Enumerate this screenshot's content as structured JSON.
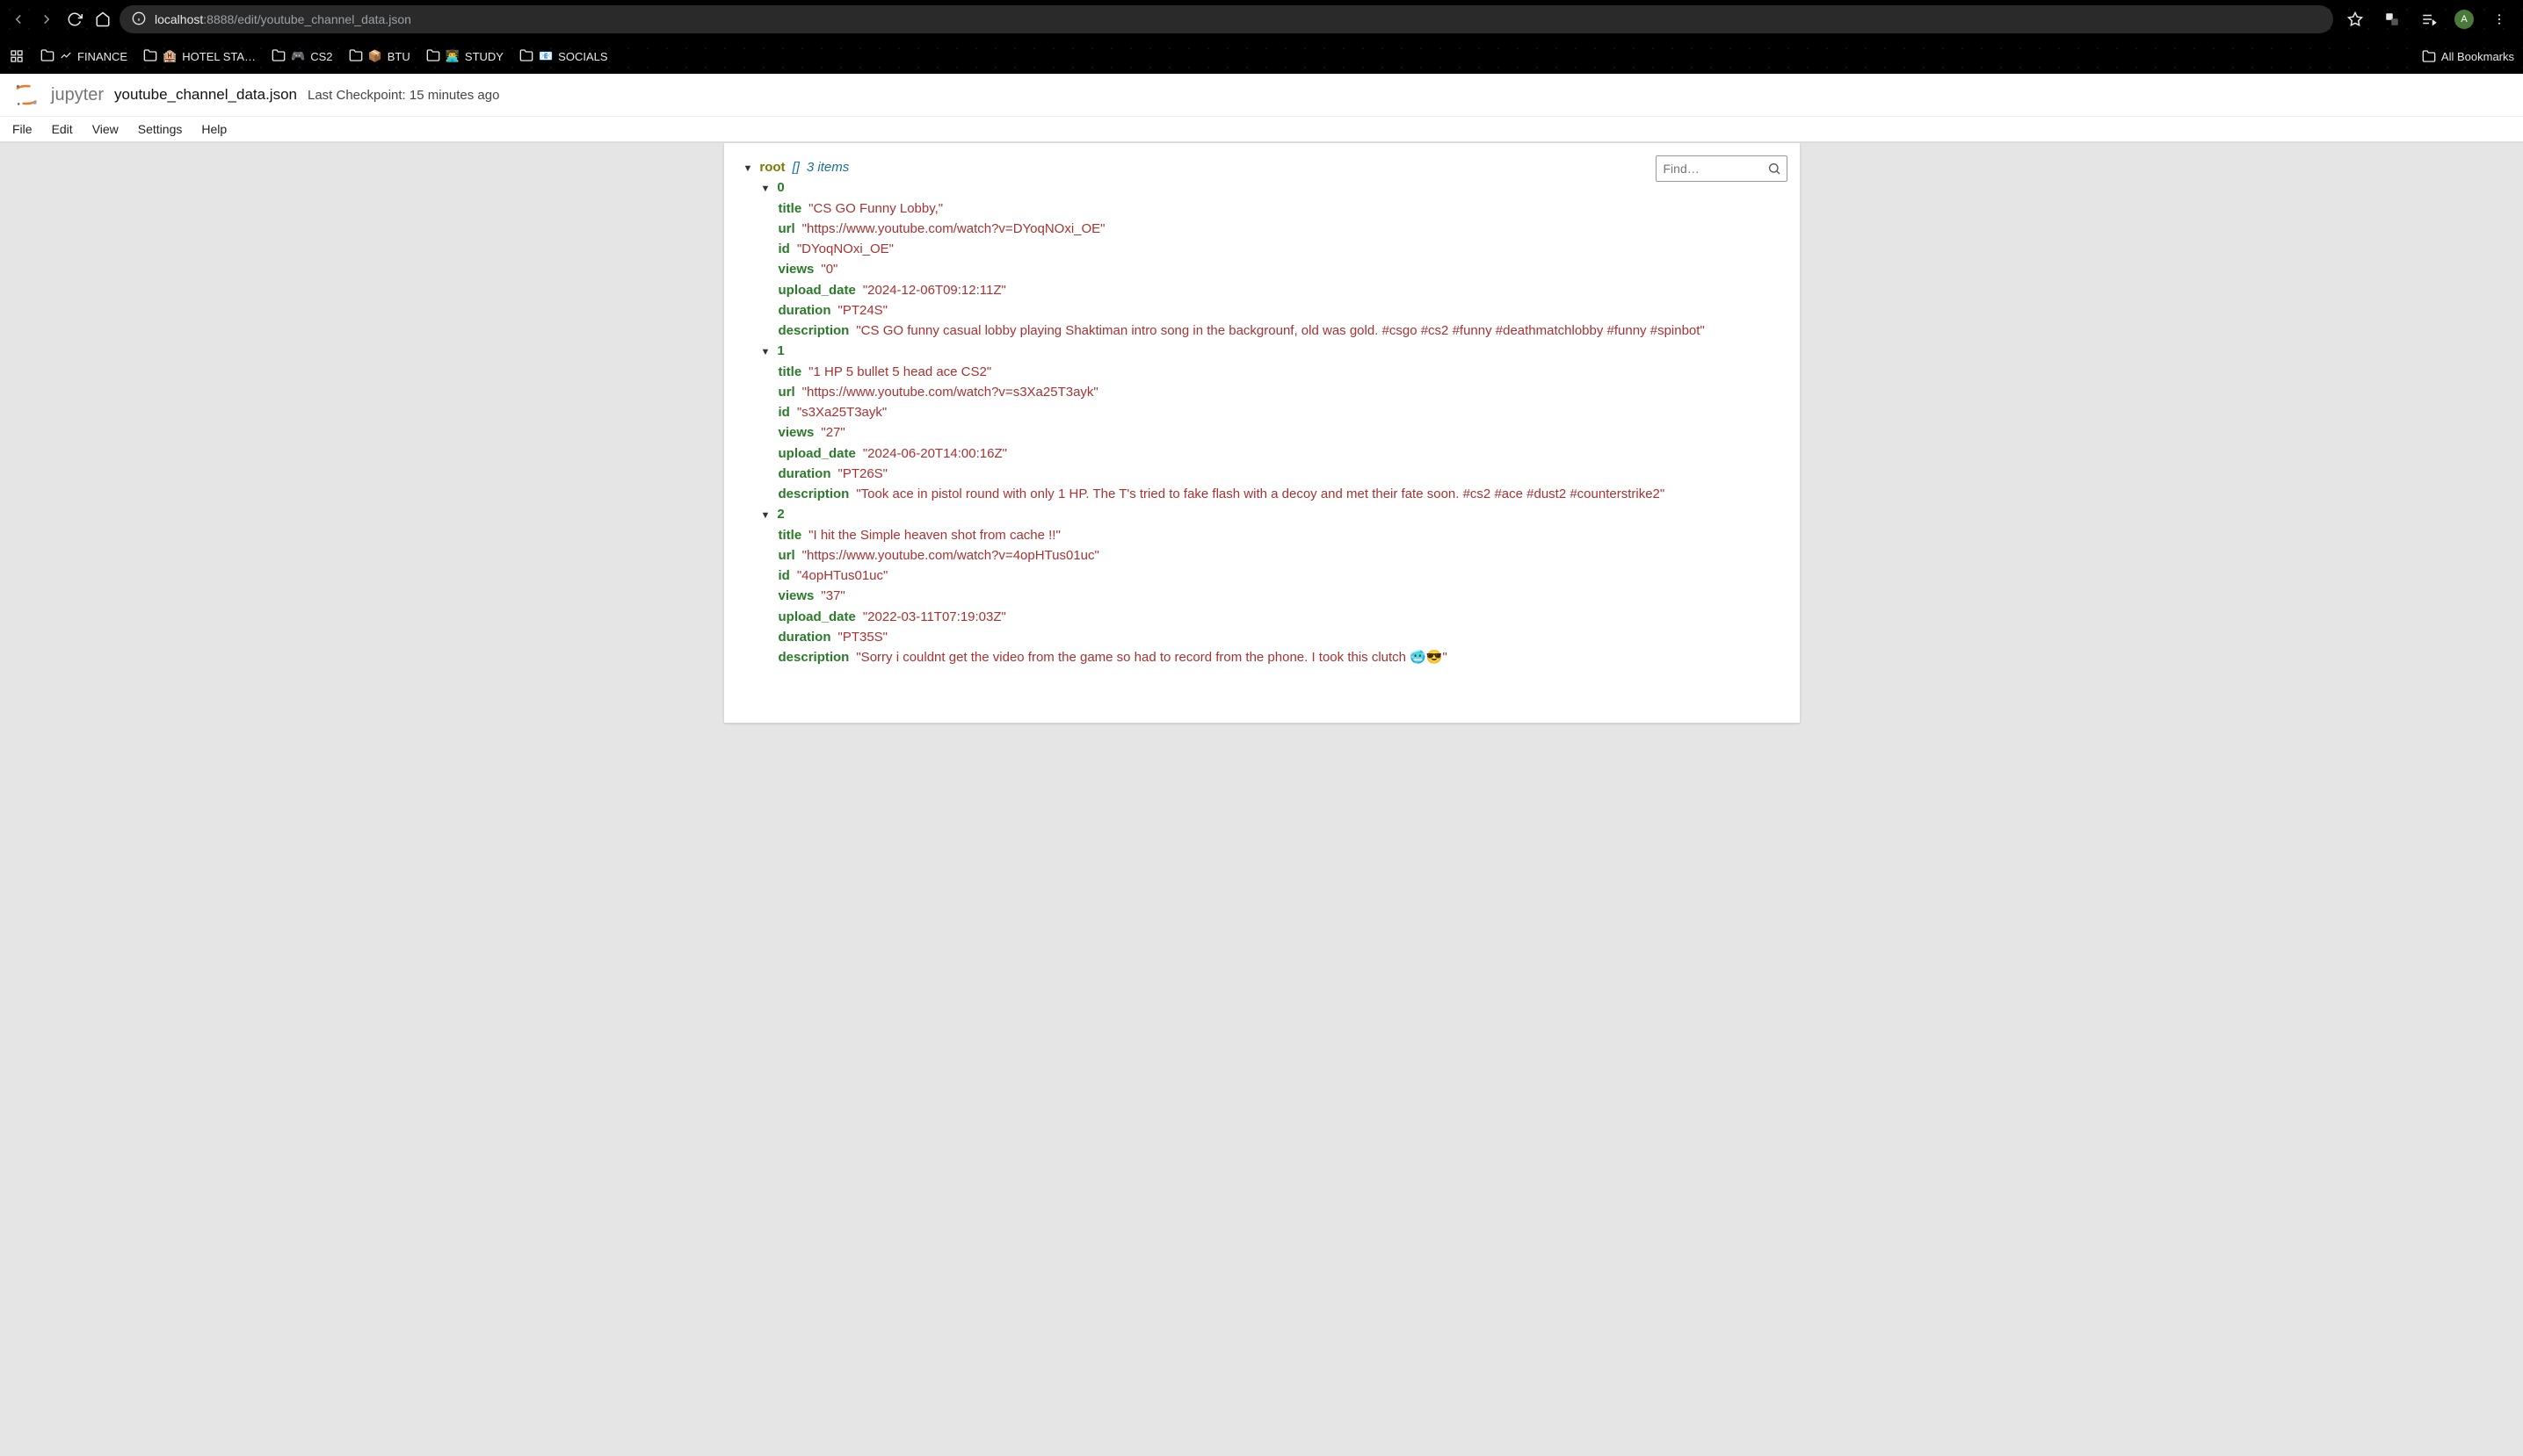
{
  "browser": {
    "url_host": "localhost",
    "url_port_path": ":8888/edit/youtube_channel_data.json",
    "avatar_letter": "A",
    "bookmarks": [
      {
        "icon": "chart",
        "label": "FINANCE"
      },
      {
        "icon": "hotel",
        "label": "HOTEL STA…"
      },
      {
        "icon": "gamepad",
        "label": "CS2"
      },
      {
        "icon": "cube",
        "label": "BTU"
      },
      {
        "icon": "study",
        "label": "STUDY"
      },
      {
        "icon": "socials",
        "label": "SOCIALS"
      }
    ],
    "all_bookmarks": "All Bookmarks"
  },
  "jupyter": {
    "brand": "jupyter",
    "file_name": "youtube_channel_data.json",
    "checkpoint": "Last Checkpoint: 15 minutes ago",
    "menus": [
      "File",
      "Edit",
      "View",
      "Settings",
      "Help"
    ],
    "find_placeholder": "Find…"
  },
  "json_view": {
    "root_label": "root",
    "root_type": "[]",
    "root_count": "3 items",
    "items": [
      {
        "index": "0",
        "props": [
          {
            "k": "title",
            "v": "\"CS GO Funny Lobby,\""
          },
          {
            "k": "url",
            "v": "\"https://www.youtube.com/watch?v=DYoqNOxi_OE\""
          },
          {
            "k": "id",
            "v": "\"DYoqNOxi_OE\""
          },
          {
            "k": "views",
            "v": "\"0\""
          },
          {
            "k": "upload_date",
            "v": "\"2024-12-06T09:12:11Z\""
          },
          {
            "k": "duration",
            "v": "\"PT24S\""
          },
          {
            "k": "description",
            "v": "\"CS GO funny casual lobby playing Shaktiman intro song in the backgrounf, old was gold. #csgo #cs2 #funny #deathmatchlobby #funny #spinbot\""
          }
        ]
      },
      {
        "index": "1",
        "props": [
          {
            "k": "title",
            "v": "\"1 HP 5 bullet 5 head ace CS2\""
          },
          {
            "k": "url",
            "v": "\"https://www.youtube.com/watch?v=s3Xa25T3ayk\""
          },
          {
            "k": "id",
            "v": "\"s3Xa25T3ayk\""
          },
          {
            "k": "views",
            "v": "\"27\""
          },
          {
            "k": "upload_date",
            "v": "\"2024-06-20T14:00:16Z\""
          },
          {
            "k": "duration",
            "v": "\"PT26S\""
          },
          {
            "k": "description",
            "v": "\"Took ace in pistol round with only 1 HP. The T's tried to fake flash with a decoy and met their fate soon. #cs2 #ace #dust2 #counterstrike2\""
          }
        ]
      },
      {
        "index": "2",
        "props": [
          {
            "k": "title",
            "v": "\"I hit the Simple heaven shot from cache !!\""
          },
          {
            "k": "url",
            "v": "\"https://www.youtube.com/watch?v=4opHTus01uc\""
          },
          {
            "k": "id",
            "v": "\"4opHTus01uc\""
          },
          {
            "k": "views",
            "v": "\"37\""
          },
          {
            "k": "upload_date",
            "v": "\"2022-03-11T07:19:03Z\""
          },
          {
            "k": "duration",
            "v": "\"PT35S\""
          },
          {
            "k": "description",
            "v": "\"Sorry i couldnt get the video from the game so had to record from the phone. I took this clutch 🥶😎\""
          }
        ]
      }
    ]
  }
}
